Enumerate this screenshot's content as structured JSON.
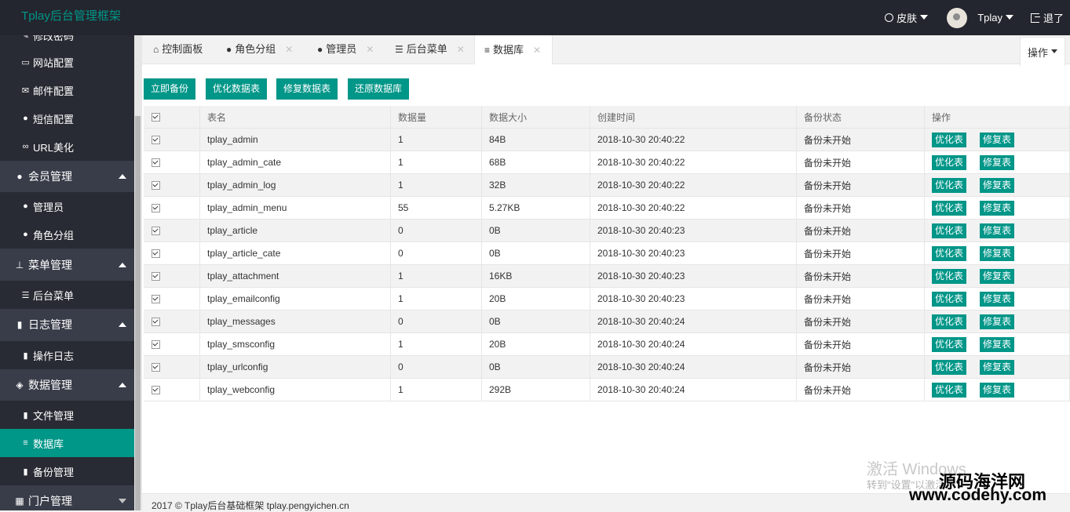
{
  "header": {
    "logo": "Tplay后台管理框架",
    "skin": "皮肤",
    "user": "Tplay",
    "logout": "退了"
  },
  "sidebar": {
    "top_partial": "修改密码",
    "items": [
      {
        "icon": "monitor-icon",
        "glyph": "▭",
        "label": "网站配置"
      },
      {
        "icon": "envelope-icon",
        "glyph": "✉",
        "label": "邮件配置"
      },
      {
        "icon": "comment-icon",
        "glyph": "●",
        "label": "短信配置"
      },
      {
        "icon": "link-icon",
        "glyph": "∞",
        "label": "URL美化"
      }
    ],
    "groups": [
      {
        "icon": "user-icon",
        "glyph": "●",
        "label": "会员管理"
      },
      {
        "icon": "sitemap-icon",
        "glyph": "⊥",
        "label": "菜单管理"
      },
      {
        "icon": "book-icon",
        "glyph": "▮",
        "label": "日志管理"
      },
      {
        "icon": "cubes-icon",
        "glyph": "◈",
        "label": "数据管理"
      },
      {
        "icon": "grid-icon",
        "glyph": "▦",
        "label": "门户管理"
      }
    ],
    "sub": {
      "member": [
        {
          "icon": "user-icon",
          "glyph": "●",
          "label": "管理员"
        },
        {
          "icon": "users-icon",
          "glyph": "●",
          "label": "角色分组"
        }
      ],
      "menu": [
        {
          "icon": "sliders-icon",
          "glyph": "☰",
          "label": "后台菜单"
        }
      ],
      "log": [
        {
          "icon": "book-icon",
          "glyph": "▮",
          "label": "操作日志"
        }
      ],
      "data": [
        {
          "icon": "file-icon",
          "glyph": "▮",
          "label": "文件管理"
        },
        {
          "icon": "database-icon",
          "glyph": "≡",
          "label": "数据库"
        },
        {
          "icon": "bookmark-icon",
          "glyph": "▮",
          "label": "备份管理"
        }
      ]
    }
  },
  "tabs": [
    {
      "icon": "home-icon",
      "glyph": "⌂",
      "label": "控制面板"
    },
    {
      "icon": "users-icon",
      "glyph": "●",
      "label": "角色分组"
    },
    {
      "icon": "user-icon",
      "glyph": "●",
      "label": "管理员"
    },
    {
      "icon": "sliders-icon",
      "glyph": "☰",
      "label": "后台菜单"
    },
    {
      "icon": "database-icon",
      "glyph": "≡",
      "label": "数据库"
    }
  ],
  "ops_label": "操作",
  "toolbar": {
    "backup": "立即备份",
    "optimize": "优化数据表",
    "repair": "修复数据表",
    "restore": "还原数据库"
  },
  "table": {
    "headers": [
      "表名",
      "数据量",
      "数据大小",
      "创建时间",
      "备份状态",
      "操作"
    ],
    "action_optimize": "优化表",
    "action_repair": "修复表",
    "rows": [
      {
        "name": "tplay_admin",
        "count": "1",
        "size": "84B",
        "created": "2018-10-30 20:40:22",
        "status": "备份未开始"
      },
      {
        "name": "tplay_admin_cate",
        "count": "1",
        "size": "68B",
        "created": "2018-10-30 20:40:22",
        "status": "备份未开始"
      },
      {
        "name": "tplay_admin_log",
        "count": "1",
        "size": "32B",
        "created": "2018-10-30 20:40:22",
        "status": "备份未开始"
      },
      {
        "name": "tplay_admin_menu",
        "count": "55",
        "size": "5.27KB",
        "created": "2018-10-30 20:40:22",
        "status": "备份未开始"
      },
      {
        "name": "tplay_article",
        "count": "0",
        "size": "0B",
        "created": "2018-10-30 20:40:23",
        "status": "备份未开始"
      },
      {
        "name": "tplay_article_cate",
        "count": "0",
        "size": "0B",
        "created": "2018-10-30 20:40:23",
        "status": "备份未开始"
      },
      {
        "name": "tplay_attachment",
        "count": "1",
        "size": "16KB",
        "created": "2018-10-30 20:40:23",
        "status": "备份未开始"
      },
      {
        "name": "tplay_emailconfig",
        "count": "1",
        "size": "20B",
        "created": "2018-10-30 20:40:23",
        "status": "备份未开始"
      },
      {
        "name": "tplay_messages",
        "count": "0",
        "size": "0B",
        "created": "2018-10-30 20:40:24",
        "status": "备份未开始"
      },
      {
        "name": "tplay_smsconfig",
        "count": "1",
        "size": "20B",
        "created": "2018-10-30 20:40:24",
        "status": "备份未开始"
      },
      {
        "name": "tplay_urlconfig",
        "count": "0",
        "size": "0B",
        "created": "2018-10-30 20:40:24",
        "status": "备份未开始"
      },
      {
        "name": "tplay_webconfig",
        "count": "1",
        "size": "292B",
        "created": "2018-10-30 20:40:24",
        "status": "备份未开始"
      }
    ]
  },
  "footer": "2017 © Tplay后台基础框架 tplay.pengyichen.cn",
  "watermark": {
    "activate": "激活 Windows",
    "goto": "转到\"设置\"以激活",
    "site_cn": "源码海洋网",
    "site_url": "www.codehy.com"
  },
  "colors": {
    "accent": "#009688",
    "header_bg": "#23262e",
    "sidebar_bg": "#393d49",
    "sidebar_sub_bg": "#282b33"
  }
}
